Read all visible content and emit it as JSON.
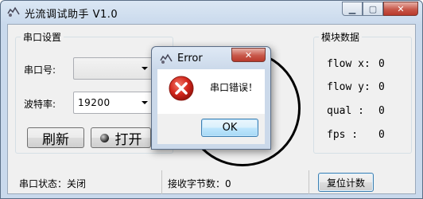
{
  "window": {
    "title": "光流调试助手 V1.0"
  },
  "serial_group": {
    "legend": "串口设置",
    "port_label": "串口号:",
    "port_value": "",
    "baud_label": "波特率:",
    "baud_value": "19200",
    "refresh_label": "刷新",
    "open_label": "打开"
  },
  "module_group": {
    "legend": "模块数据",
    "rows": [
      {
        "label": "flow x:",
        "value": "0"
      },
      {
        "label": "flow y:",
        "value": "0"
      },
      {
        "label": "qual  :",
        "value": "0"
      },
      {
        "label": "fps   :",
        "value": "0"
      }
    ]
  },
  "status": {
    "port_state": "串口状态：关闭",
    "bytes_received": "接收字节数：0",
    "reset_label": "复位计数"
  },
  "dialog": {
    "title": "Error",
    "message": "串口错误！",
    "ok_label": "OK"
  }
}
